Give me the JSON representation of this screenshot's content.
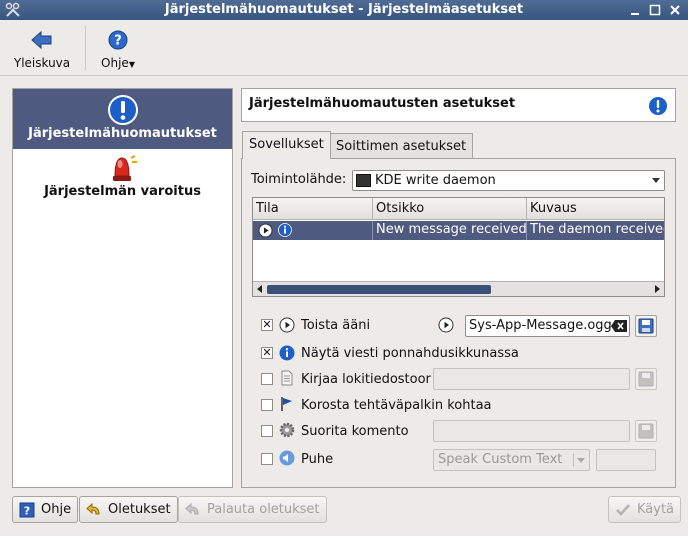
{
  "window": {
    "title": "Järjestelmähuomautukset - Järjestelmäasetukset",
    "controls": [
      "minimize-icon",
      "maximize-icon",
      "close-icon"
    ]
  },
  "toolbar": {
    "overview_label": "Yleiskuva",
    "help_label": "Ohje"
  },
  "sidebar": {
    "items": [
      {
        "label": "Järjestelmähuomautukset",
        "icon": "info-icon",
        "selected": true
      },
      {
        "label": "Järjestelmän varoitus",
        "icon": "alarm-bell-icon",
        "selected": false
      }
    ]
  },
  "header": {
    "title": "Järjestelmähuomautusten asetukset"
  },
  "tabs": [
    {
      "label": "Sovellukset",
      "active": true
    },
    {
      "label": "Soittimen asetukset",
      "active": false
    }
  ],
  "source": {
    "label": "Toimintolähde:",
    "value": "KDE write daemon"
  },
  "events_table": {
    "columns": [
      "Tila",
      "Otsikko",
      "Kuvaus"
    ],
    "rows": [
      {
        "title": "New message received",
        "description": "The daemon received"
      }
    ]
  },
  "options": {
    "play_sound": {
      "label": "Toista ääni",
      "checked": true,
      "file": "Sys-App-Message.ogg"
    },
    "show_popup": {
      "label": "Näytä viesti ponnahdusikkunassa",
      "checked": true
    },
    "log_file": {
      "label": "Kirjaa lokitiedostoor",
      "checked": false
    },
    "mark_taskbar": {
      "label": "Korosta tehtäväpalkin kohtaa",
      "checked": false
    },
    "run_command": {
      "label": "Suorita komento",
      "checked": false
    },
    "speech": {
      "label": "Puhe",
      "checked": false,
      "mode": "Speak Custom Text"
    }
  },
  "buttons": {
    "help": "Ohje",
    "defaults": "Oletukset",
    "reset": "Palauta oletukset",
    "apply": "Käytä"
  },
  "colors": {
    "titlebar": "#3f5c87",
    "selection": "#4f5a80",
    "accent_blue": "#1c5fc7"
  }
}
